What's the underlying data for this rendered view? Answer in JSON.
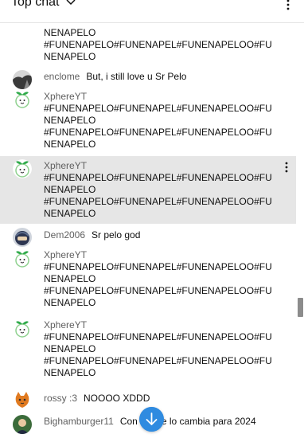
{
  "header": {
    "title": "Top chat"
  },
  "messages": [
    {
      "author": "",
      "text": "NENAPELO\n#FUNENAPELO#FUNENAPEL#FUNENAPELOO#FUNENAPELO",
      "avatar": "none"
    },
    {
      "author": "enclome",
      "text": "But, i still love u Sr Pelo",
      "avatar": "anime-avatar"
    },
    {
      "author": "XphereYT",
      "text": "#FUNENAPELO#FUNENAPEL#FUNENAPELOO#FUNENAPELO\n#FUNENAPELO#FUNENAPEL#FUNENAPELOO#FUNENAPELO",
      "avatar": "sprout-avatar"
    },
    {
      "author": "XphereYT",
      "text": "#FUNENAPELO#FUNENAPEL#FUNENAPELOO#FUNENAPELO\n#FUNENAPELO#FUNENAPEL#FUNENAPELOO#FUNENAPELO",
      "avatar": "sprout-avatar",
      "highlighted": true
    },
    {
      "author": "Dem2006",
      "text": "Sr pelo god",
      "avatar": "helmet-avatar"
    },
    {
      "author": "XphereYT",
      "text": "#FUNENAPELO#FUNENAPEL#FUNENAPELOO#FUNENAPELO\n#FUNENAPELO#FUNENAPEL#FUNENAPELOO#FUNENAPELO",
      "avatar": "sprout-avatar"
    },
    {
      "author": "XphereYT",
      "text": "#FUNENAPELO#FUNENAPEL#FUNENAPELOO#FUNENAPELO\n#FUNENAPELO#FUNENAPEL#FUNENAPELOO#FUNENAPELO",
      "avatar": "sprout-avatar"
    },
    {
      "author": "rossy :3",
      "text": "NOOOO XDDD",
      "avatar": "cat-avatar"
    },
    {
      "author": "Bighamburger11",
      "text": "Con suerte lo cambia para 2024",
      "avatar": "character-avatar"
    }
  ],
  "icons": {
    "header_menu": "chevron-down-icon",
    "header_more": "more-vert-icon",
    "scroll_down": "arrow-down-icon"
  },
  "colors": {
    "author": "#606060",
    "text": "#0f0f0f",
    "highlight": "#e6e6e6",
    "fab": "#2f8be0"
  }
}
